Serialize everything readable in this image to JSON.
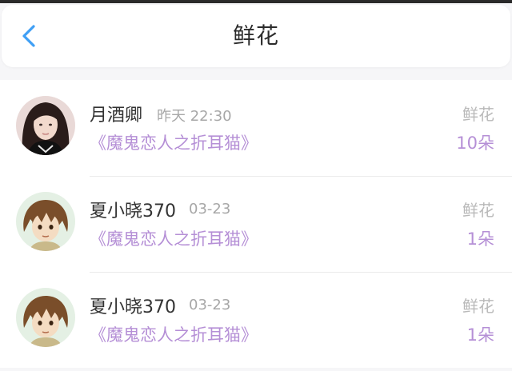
{
  "header": {
    "title": "鲜花",
    "back_icon": "chevron-left-icon",
    "accent_color": "#3f9ff5"
  },
  "items": [
    {
      "name": "月酒卿",
      "time": "昨天 22:30",
      "book": "《魔鬼恋人之折耳猫》",
      "gift": "鲜花",
      "count": "10朵",
      "avatar_icon": "user-avatar-photo"
    },
    {
      "name": "夏小晓370",
      "time": "03-23",
      "book": "《魔鬼恋人之折耳猫》",
      "gift": "鲜花",
      "count": "1朵",
      "avatar_icon": "user-avatar-anime"
    },
    {
      "name": "夏小晓370",
      "time": "03-23",
      "book": "《魔鬼恋人之折耳猫》",
      "gift": "鲜花",
      "count": "1朵",
      "avatar_icon": "user-avatar-anime"
    }
  ],
  "colors": {
    "book_link": "#b58fd6",
    "secondary_text": "#a7a7a7",
    "primary_text": "#333333"
  }
}
